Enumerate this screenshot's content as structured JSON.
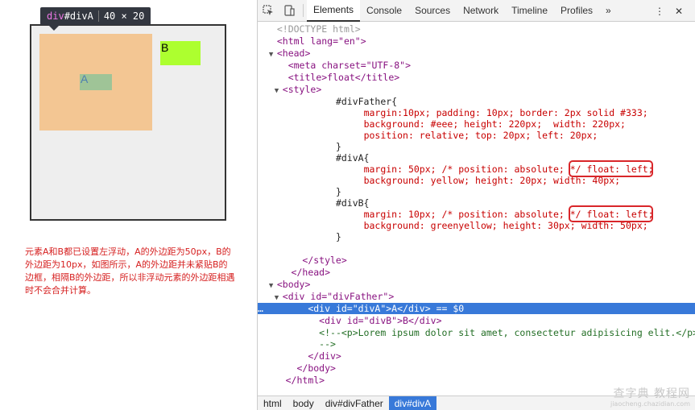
{
  "render": {
    "tooltip": {
      "tag": "div",
      "id": "#divA",
      "size": "40 × 20"
    },
    "box_a_label": "A",
    "box_b_label": "B",
    "note": "元素A和B都已设置左浮动，A的外边距为50px，B的外边距为10px，如图所示，A的外边距并未紧贴B的边框，相隔B的外边距，所以非浮动元素的外边距相遇时不会合并计算。"
  },
  "toolbar": {
    "tabs": [
      "Elements",
      "Console",
      "Sources",
      "Network",
      "Timeline",
      "Profiles"
    ],
    "active_tab": "Elements",
    "more": "»",
    "menu": "⋮",
    "close": "✕"
  },
  "code": {
    "doctype": "<!DOCTYPE html>",
    "html_open": "<html lang=\"en\">",
    "head_open": "<head>",
    "meta": "<meta charset=\"UTF-8\">",
    "title": "<title>float</title>",
    "style_open": "<style>",
    "father_sel": "#divFather{",
    "father_l1": "margin:10px; padding: 10px; border: 2px solid #333;",
    "father_l2": "background: #eee; height: 220px;  width: 220px;",
    "father_l3": "position: relative; top: 20px; left: 20px;",
    "close_brace": "}",
    "diva_sel": "#divA{",
    "diva_l1": "margin: 50px; /* position: absolute; */ float: left;",
    "diva_l2": "background: yellow; height: 20px; width: 40px;",
    "divb_sel": "#divB{",
    "divb_l1": "margin: 10px; /* position: absolute; */ float: left;",
    "divb_l2": "background: greenyellow; height: 30px; width: 50px;",
    "style_close": "</style>",
    "head_close": "</head>",
    "body_open": "<body>",
    "father_div": "<div id=\"divFather\">",
    "diva_div": "<div id=\"divA\">A</div> == $0",
    "divb_div": "<div id=\"divB\">B</div>",
    "comment_l1": "<!--<p>Lorem ipsum dolor sit amet, consectetur adipisicing elit.</p>",
    "comment_l2": "-->",
    "div_close": "</div>",
    "body_close": "</body>",
    "html_close": "</html>",
    "ellipsis": "…"
  },
  "breadcrumbs": [
    "html",
    "body",
    "div#divFather",
    "div#divA"
  ],
  "watermark": {
    "main": "查字典 教程网",
    "sub": "jiaocheng.chazidian.com"
  },
  "colors": {
    "selected_row": "#3879d9",
    "highlight_box": "#d9262a",
    "note_text": "#d62020"
  },
  "icons": [
    "inspect-icon",
    "device-icon",
    "more-tabs-icon",
    "menu-icon",
    "close-icon"
  ]
}
